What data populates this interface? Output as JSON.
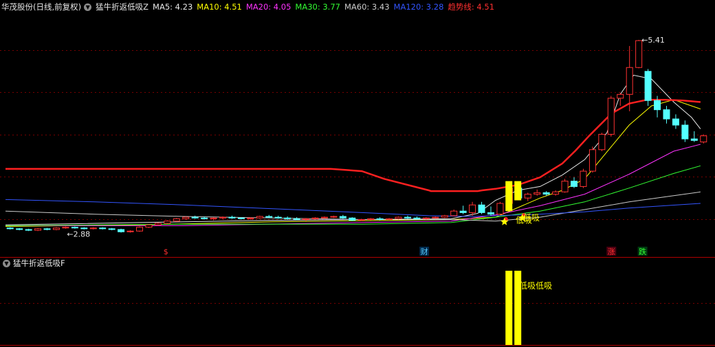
{
  "header": {
    "stock_name": "华茂股份(日线,前复权)",
    "indicator_name": "猛牛折返低吸Z",
    "ma_items": [
      {
        "label": "MA5: 4.23",
        "color": "#e8e8e8"
      },
      {
        "label": "MA10: 4.51",
        "color": "#ffff00"
      },
      {
        "label": "MA20: 4.05",
        "color": "#ff33ff"
      },
      {
        "label": "MA30: 3.77",
        "color": "#33ff33"
      },
      {
        "label": "MA60: 3.43",
        "color": "#cccccc"
      },
      {
        "label": "MA120: 3.28",
        "color": "#3355ff"
      },
      {
        "label": "趋势线: 4.51",
        "color": "#ff3030"
      }
    ]
  },
  "sub_panel": {
    "title": "猛牛折返低吸F"
  },
  "chart_data": [
    {
      "type": "candlestick",
      "title": "猛牛折返低吸Z",
      "ylim": [
        2.6,
        5.75
      ],
      "price_labels": {
        "high": "5.41",
        "low": "2.88"
      },
      "high_value": 5.41,
      "low_value": 2.88,
      "colors": {
        "up": "#ff3232",
        "down": "#54ffff",
        "signal": "#ffff00"
      },
      "candles": [
        [
          2.96,
          2.97,
          2.94,
          2.95
        ],
        [
          2.95,
          2.96,
          2.93,
          2.94
        ],
        [
          2.94,
          2.95,
          2.92,
          2.93
        ],
        [
          2.93,
          2.96,
          2.92,
          2.95
        ],
        [
          2.95,
          2.96,
          2.93,
          2.94
        ],
        [
          2.94,
          2.97,
          2.93,
          2.96
        ],
        [
          2.96,
          2.98,
          2.95,
          2.97
        ],
        [
          2.97,
          2.98,
          2.95,
          2.96
        ],
        [
          2.96,
          2.97,
          2.94,
          2.95
        ],
        [
          2.95,
          2.97,
          2.94,
          2.96
        ],
        [
          2.96,
          2.97,
          2.94,
          2.95
        ],
        [
          2.95,
          2.96,
          2.93,
          2.94
        ],
        [
          2.94,
          2.95,
          2.9,
          2.91
        ],
        [
          2.91,
          2.93,
          2.9,
          2.92
        ],
        [
          2.92,
          2.98,
          2.91,
          2.97
        ],
        [
          2.97,
          3.01,
          2.96,
          3.0
        ],
        [
          3.0,
          3.03,
          2.99,
          3.02
        ],
        [
          3.02,
          3.06,
          3.01,
          3.05
        ],
        [
          3.05,
          3.09,
          3.04,
          3.08
        ],
        [
          3.08,
          3.11,
          3.07,
          3.1
        ],
        [
          3.1,
          3.12,
          3.08,
          3.09
        ],
        [
          3.09,
          3.11,
          3.07,
          3.08
        ],
        [
          3.08,
          3.1,
          3.06,
          3.09
        ],
        [
          3.09,
          3.11,
          3.07,
          3.1
        ],
        [
          3.1,
          3.12,
          3.08,
          3.09
        ],
        [
          3.09,
          3.1,
          3.07,
          3.08
        ],
        [
          3.08,
          3.1,
          3.07,
          3.09
        ],
        [
          3.09,
          3.12,
          3.08,
          3.11
        ],
        [
          3.11,
          3.13,
          3.09,
          3.1
        ],
        [
          3.1,
          3.12,
          3.08,
          3.09
        ],
        [
          3.09,
          3.11,
          3.07,
          3.08
        ],
        [
          3.08,
          3.1,
          3.06,
          3.07
        ],
        [
          3.07,
          3.09,
          3.05,
          3.08
        ],
        [
          3.08,
          3.1,
          3.07,
          3.09
        ],
        [
          3.09,
          3.11,
          3.08,
          3.1
        ],
        [
          3.1,
          3.12,
          3.09,
          3.11
        ],
        [
          3.11,
          3.13,
          3.08,
          3.09
        ],
        [
          3.09,
          3.1,
          3.05,
          3.06
        ],
        [
          3.06,
          3.08,
          3.05,
          3.07
        ],
        [
          3.07,
          3.09,
          3.06,
          3.08
        ],
        [
          3.08,
          3.1,
          3.06,
          3.07
        ],
        [
          3.07,
          3.09,
          3.06,
          3.08
        ],
        [
          3.08,
          3.11,
          3.07,
          3.1
        ],
        [
          3.1,
          3.12,
          3.08,
          3.09
        ],
        [
          3.09,
          3.11,
          3.07,
          3.08
        ],
        [
          3.08,
          3.1,
          3.07,
          3.09
        ],
        [
          3.09,
          3.11,
          3.08,
          3.1
        ],
        [
          3.1,
          3.13,
          3.09,
          3.12
        ],
        [
          3.12,
          3.2,
          3.11,
          3.18
        ],
        [
          3.18,
          3.25,
          3.14,
          3.16
        ],
        [
          3.16,
          3.3,
          3.12,
          3.26
        ],
        [
          3.26,
          3.3,
          3.14,
          3.16
        ],
        [
          3.16,
          3.24,
          3.12,
          3.14
        ],
        [
          3.14,
          3.3,
          3.13,
          3.28
        ],
        [
          3.28,
          3.5,
          3.27,
          3.48
        ],
        [
          3.48,
          3.5,
          3.33,
          3.35
        ],
        [
          3.35,
          3.42,
          3.31,
          3.4
        ],
        [
          3.4,
          3.46,
          3.38,
          3.42
        ],
        [
          3.42,
          3.44,
          3.38,
          3.4
        ],
        [
          3.4,
          3.45,
          3.38,
          3.43
        ],
        [
          3.43,
          3.6,
          3.42,
          3.57
        ],
        [
          3.57,
          3.62,
          3.48,
          3.5
        ],
        [
          3.5,
          3.73,
          3.48,
          3.7
        ],
        [
          3.7,
          4.02,
          3.68,
          3.98
        ],
        [
          3.98,
          4.2,
          3.96,
          4.18
        ],
        [
          4.18,
          4.68,
          4.15,
          4.65
        ],
        [
          4.65,
          4.72,
          4.55,
          4.7
        ],
        [
          4.7,
          5.33,
          4.48,
          5.05
        ],
        [
          5.05,
          5.41,
          5.04,
          5.4
        ],
        [
          5.0,
          5.03,
          4.55,
          4.62
        ],
        [
          4.62,
          4.68,
          4.4,
          4.5
        ],
        [
          4.5,
          4.55,
          4.32,
          4.38
        ],
        [
          4.38,
          4.44,
          4.25,
          4.3
        ],
        [
          4.3,
          4.36,
          4.08,
          4.12
        ],
        [
          4.12,
          4.22,
          4.08,
          4.1
        ],
        [
          4.08,
          4.18,
          4.06,
          4.16
        ]
      ],
      "trend_line": [
        [
          0,
          3.73
        ],
        [
          73,
          3.73
        ],
        [
          80,
          3.7
        ],
        [
          85,
          3.6
        ],
        [
          95,
          3.45
        ],
        [
          95.5,
          3.44
        ],
        [
          102,
          3.44
        ],
        [
          106,
          3.44
        ],
        [
          107,
          3.45
        ],
        [
          110,
          3.47
        ],
        [
          115,
          3.52
        ],
        [
          120,
          3.62
        ],
        [
          125,
          3.8
        ],
        [
          128,
          3.97
        ],
        [
          131,
          4.16
        ],
        [
          136,
          4.45
        ],
        [
          140,
          4.58
        ],
        [
          144,
          4.63
        ],
        [
          148,
          4.63
        ],
        [
          152,
          4.62
        ],
        [
          154,
          4.61
        ],
        [
          156,
          4.6
        ]
      ],
      "ma_series": [
        {
          "color": "#e8e8e8",
          "points": [
            [
              0,
              3.0
            ],
            [
              30,
              3.03
            ],
            [
              60,
              3.06
            ],
            [
              100,
              3.08
            ],
            [
              106,
              3.15
            ],
            [
              110,
              3.32
            ],
            [
              115,
              3.45
            ],
            [
              120,
              3.5
            ],
            [
              125,
              3.65
            ],
            [
              130,
              3.85
            ],
            [
              135,
              4.2
            ],
            [
              138,
              4.7
            ],
            [
              141,
              4.95
            ],
            [
              145,
              4.9
            ],
            [
              150,
              4.6
            ],
            [
              154,
              4.4
            ],
            [
              156,
              4.25
            ]
          ]
        },
        {
          "color": "#ffff00",
          "points": [
            [
              0,
              2.98
            ],
            [
              30,
              3.0
            ],
            [
              60,
              3.04
            ],
            [
              100,
              3.07
            ],
            [
              110,
              3.1
            ],
            [
              120,
              3.35
            ],
            [
              125,
              3.45
            ],
            [
              130,
              3.6
            ],
            [
              135,
              3.95
            ],
            [
              140,
              4.3
            ],
            [
              145,
              4.55
            ],
            [
              150,
              4.63
            ],
            [
              156,
              4.51
            ]
          ]
        },
        {
          "color": "#ff33ff",
          "points": [
            [
              0,
              2.99
            ],
            [
              40,
              2.99
            ],
            [
              80,
              3.03
            ],
            [
              100,
              3.05
            ],
            [
              110,
              3.13
            ],
            [
              120,
              3.25
            ],
            [
              130,
              3.4
            ],
            [
              140,
              3.66
            ],
            [
              150,
              3.96
            ],
            [
              156,
              4.05
            ]
          ]
        },
        {
          "color": "#33ff33",
          "points": [
            [
              0,
              2.99
            ],
            [
              40,
              3.01
            ],
            [
              80,
              3.01
            ],
            [
              100,
              3.03
            ],
            [
              110,
              3.1
            ],
            [
              120,
              3.18
            ],
            [
              130,
              3.3
            ],
            [
              140,
              3.48
            ],
            [
              150,
              3.67
            ],
            [
              156,
              3.77
            ]
          ]
        },
        {
          "color": "#cccccc",
          "points": [
            [
              0,
              3.18
            ],
            [
              20,
              3.14
            ],
            [
              40,
              3.11
            ],
            [
              60,
              3.09
            ],
            [
              80,
              3.07
            ],
            [
              100,
              3.07
            ],
            [
              110,
              3.05
            ],
            [
              120,
              3.1
            ],
            [
              130,
              3.2
            ],
            [
              140,
              3.3
            ],
            [
              150,
              3.38
            ],
            [
              156,
              3.43
            ]
          ]
        },
        {
          "color": "#3355ff",
          "points": [
            [
              0,
              3.33
            ],
            [
              20,
              3.3
            ],
            [
              40,
              3.26
            ],
            [
              60,
              3.21
            ],
            [
              80,
              3.16
            ],
            [
              95,
              3.12
            ],
            [
              105,
              3.11
            ],
            [
              110,
              3.12
            ],
            [
              120,
              3.14
            ],
            [
              130,
              3.17
            ],
            [
              140,
              3.22
            ],
            [
              156,
              3.28
            ]
          ]
        }
      ],
      "signal_bars": [
        {
          "index": 113,
          "top": 3.57,
          "bottom": 3.18
        },
        {
          "index": 115,
          "top": 3.57,
          "bottom": 3.32
        }
      ],
      "stars": [
        {
          "index": 112,
          "value": 3.04
        },
        {
          "index": 116,
          "value": 3.09
        }
      ],
      "star_labels": [
        {
          "index": 114.5,
          "value": 3.06,
          "text": "低吸"
        },
        {
          "index": 116.2,
          "value": 3.09,
          "text": "低吸"
        }
      ],
      "event_markers": [
        {
          "index": 36,
          "text": "$",
          "color": "#ff3030",
          "bg": ""
        },
        {
          "index": 94,
          "text": "财",
          "color": "#55ccff",
          "bg": "#00284a"
        },
        {
          "index": 136,
          "text": "涨",
          "color": "#ff3030",
          "bg": "#4a0010"
        },
        {
          "index": 143,
          "text": "跌",
          "color": "#33ff33",
          "bg": "#003a10"
        }
      ]
    },
    {
      "type": "bar",
      "title": "猛牛折返低吸F",
      "bars": [
        {
          "index": 113,
          "value": 1
        },
        {
          "index": 115,
          "value": 1
        }
      ],
      "label": {
        "index": 115.3,
        "text": "低吸低吸"
      }
    }
  ]
}
